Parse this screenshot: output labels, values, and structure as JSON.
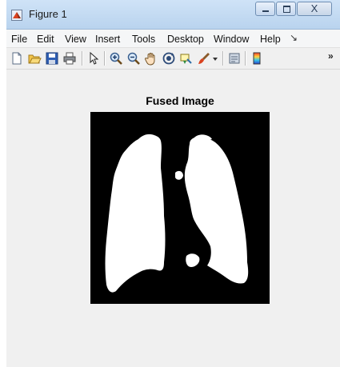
{
  "window": {
    "title": "Figure 1",
    "app_icon": "matlab-figure-icon",
    "controls": {
      "minimize": "minimize-icon",
      "maximize": "maximize-icon",
      "close_label": "X"
    }
  },
  "menu": {
    "items": [
      {
        "label": "File"
      },
      {
        "label": "Edit"
      },
      {
        "label": "View"
      },
      {
        "label": "Insert"
      },
      {
        "label": "Tools"
      },
      {
        "label": "Desktop"
      },
      {
        "label": "Window"
      },
      {
        "label": "Help"
      }
    ],
    "overflow_icon": "menu-overflow-icon"
  },
  "toolbar": {
    "buttons": [
      "new-figure-icon",
      "open-file-icon",
      "save-icon",
      "print-icon",
      "pointer-icon",
      "zoom-in-icon",
      "zoom-out-icon",
      "pan-hand-icon",
      "rotate-3d-icon",
      "data-cursor-icon",
      "brush-icon",
      "dropdown-arrow-icon",
      "link-plot-icon",
      "colorbar-icon"
    ],
    "overflow_label": "»"
  },
  "figure": {
    "axes_title": "Fused Image",
    "image_content": "binary-lung-mask",
    "colors": {
      "background": "#000000",
      "foreground": "#ffffff",
      "canvas": "#f0f0f0"
    }
  }
}
